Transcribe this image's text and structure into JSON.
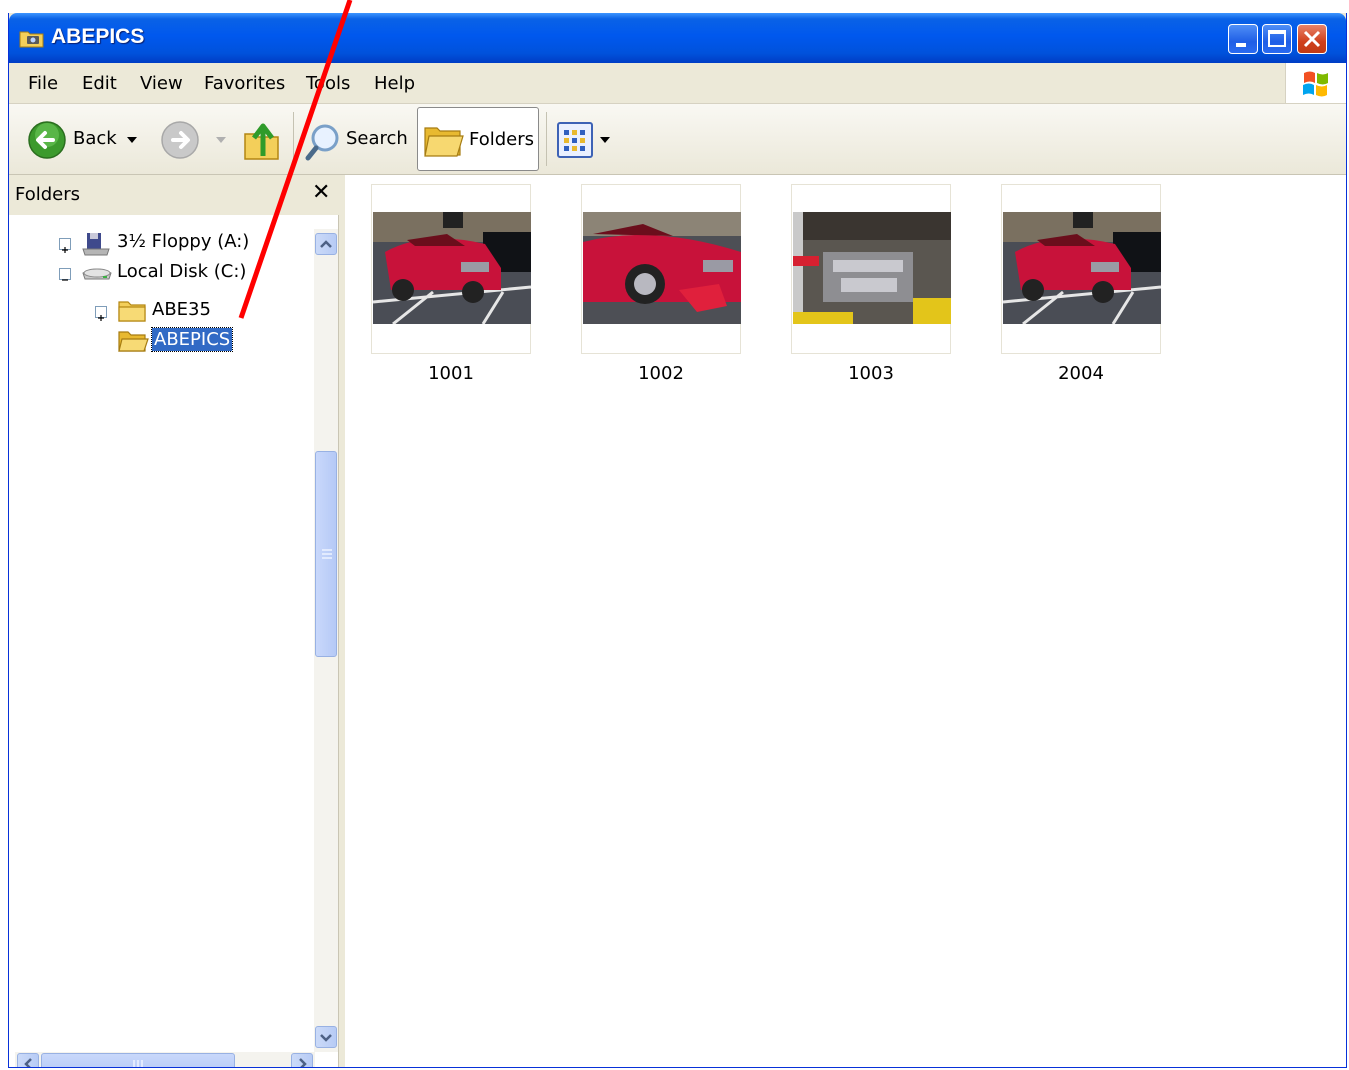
{
  "window": {
    "title": "ABEPICS"
  },
  "menu": [
    "File",
    "Edit",
    "View",
    "Favorites",
    "Tools",
    "Help"
  ],
  "toolbar": {
    "back_label": "Back",
    "search_label": "Search",
    "folders_label": "Folders"
  },
  "folders_pane": {
    "title": "Folders",
    "tree": [
      {
        "label": "3½ Floppy (A:)",
        "icon": "floppy-drive-icon"
      },
      {
        "label": "Local Disk (C:)",
        "icon": "hard-drive-icon"
      },
      {
        "label": "ABE35",
        "icon": "folder-icon"
      },
      {
        "label": "ABEPICS",
        "icon": "folder-open-icon",
        "selected": true
      }
    ]
  },
  "files": [
    {
      "name": "1001"
    },
    {
      "name": "1002"
    },
    {
      "name": "1003"
    },
    {
      "name": "2004"
    }
  ],
  "colors": {
    "titlebar": "#0058ee",
    "selection": "#316ac5",
    "annotation": "#ff0000",
    "car": "#c8123a"
  }
}
